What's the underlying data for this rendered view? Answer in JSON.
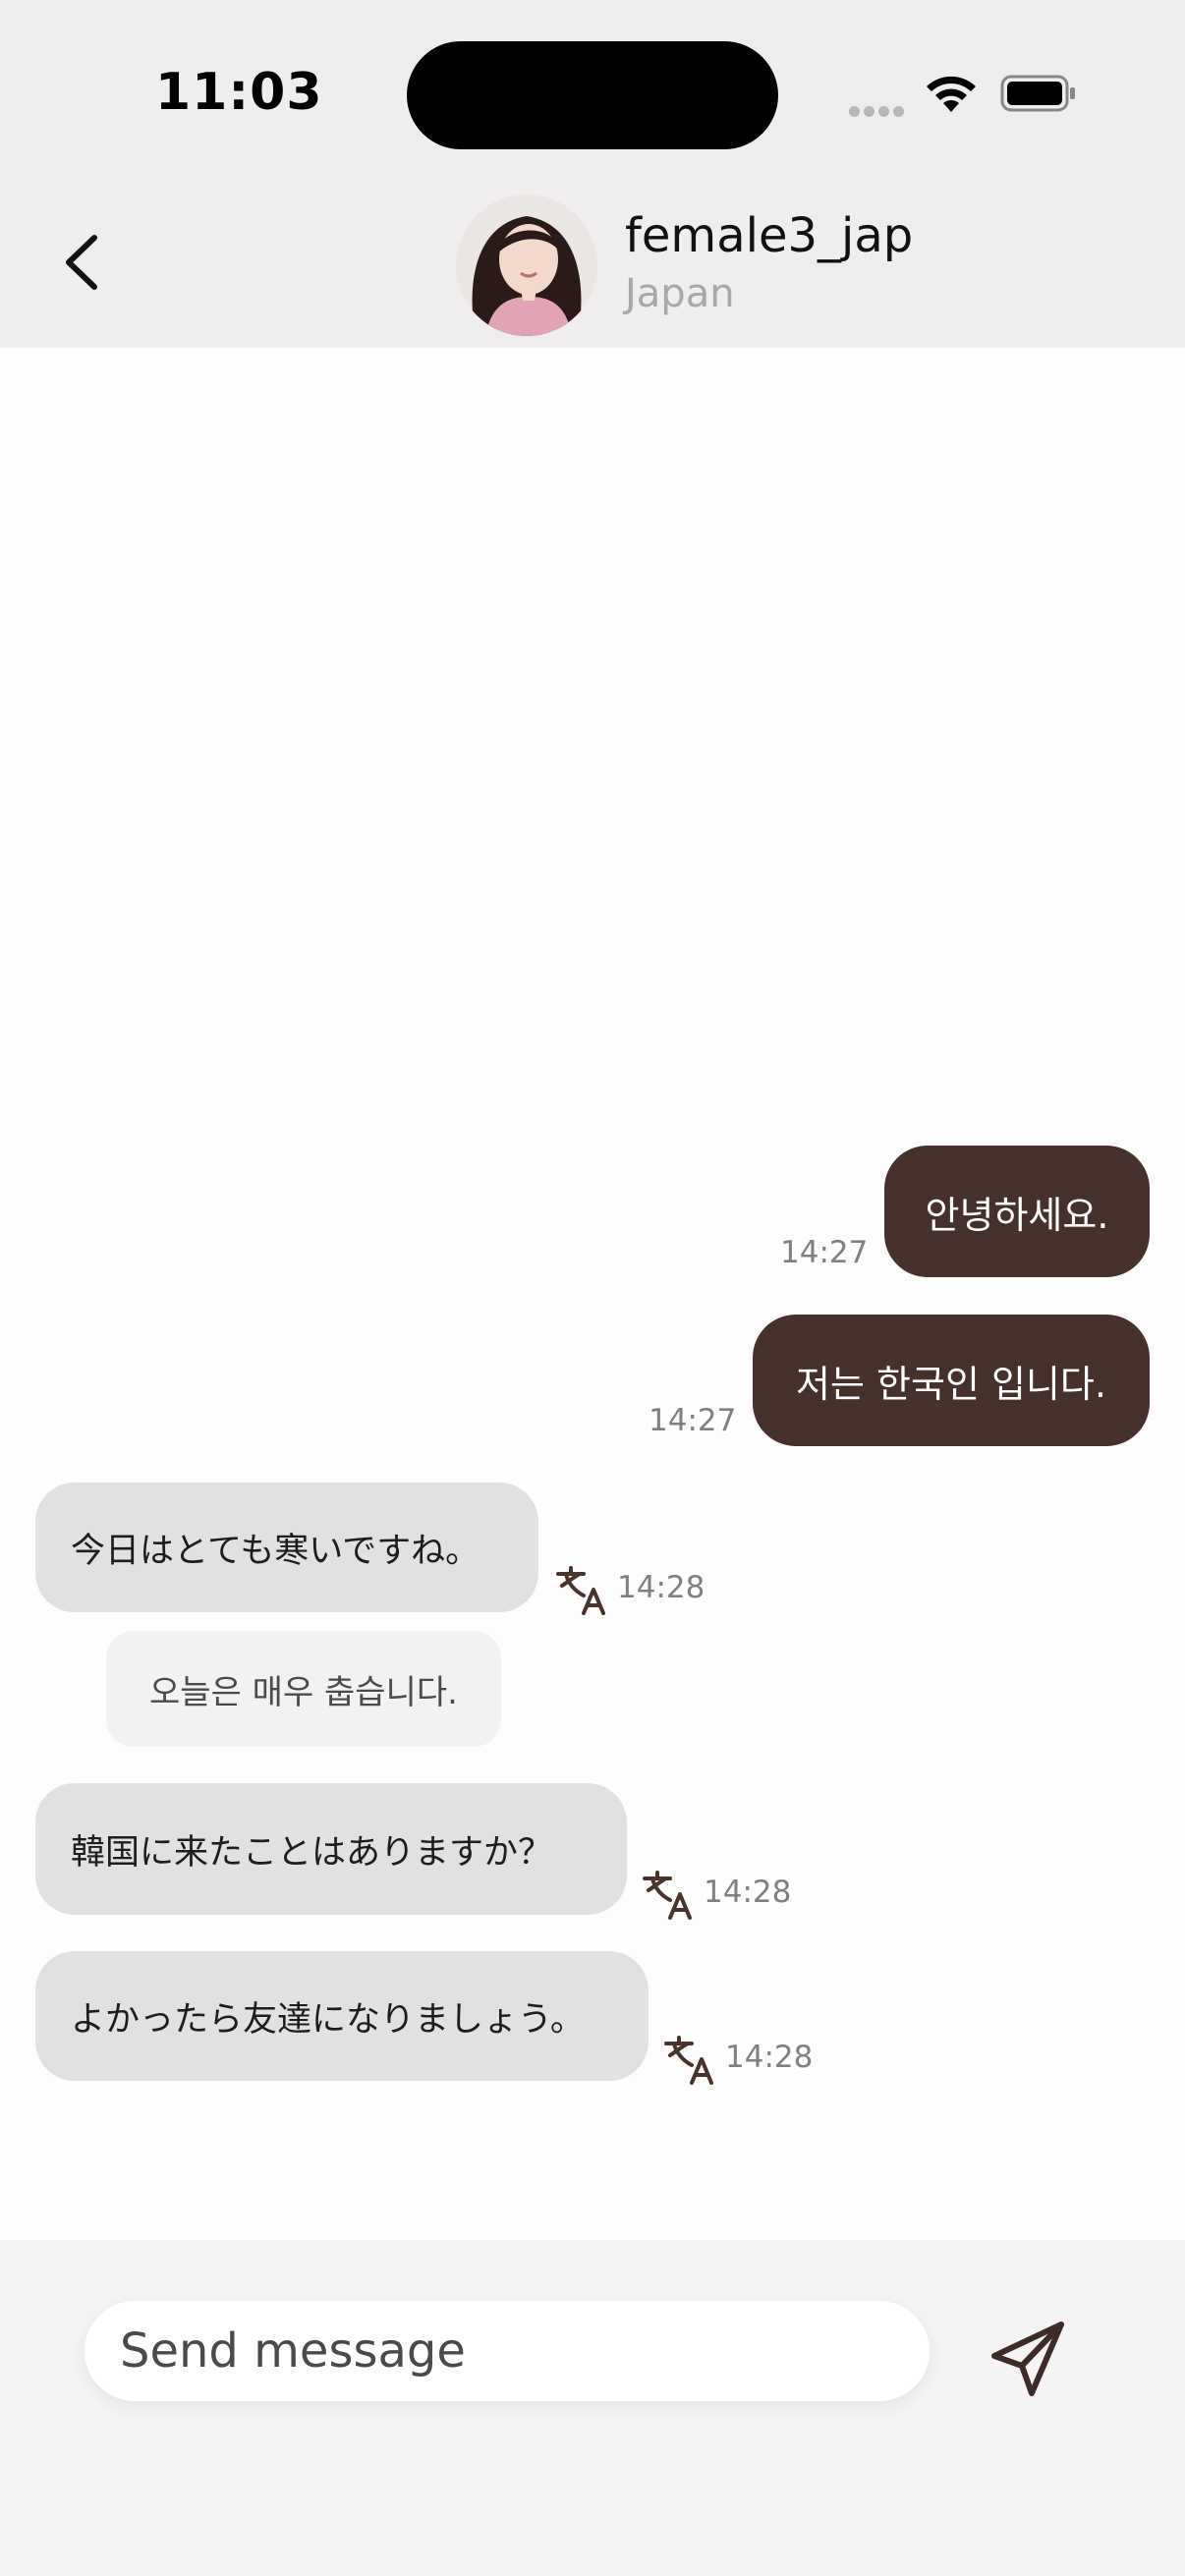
{
  "status_bar": {
    "time": "11:03"
  },
  "header": {
    "back_icon": "chevron-left-icon",
    "name": "female3_jap",
    "country": "Japan"
  },
  "messages": [
    {
      "direction": "out",
      "text": "안녕하세요.",
      "time": "14:27"
    },
    {
      "direction": "out",
      "text": "저는 한국인 입니다.",
      "time": "14:27"
    },
    {
      "direction": "in",
      "text": "今日はとても寒いですね。",
      "time": "14:28",
      "translation": "오늘은 매우 춥습니다."
    },
    {
      "direction": "in",
      "text": "韓国に来たことはありますか？",
      "time": "14:28"
    },
    {
      "direction": "in",
      "text": "よかったら友達になりましょう。",
      "time": "14:28"
    }
  ],
  "composer": {
    "placeholder": "Send message",
    "send_icon": "paper-plane-icon"
  },
  "colors": {
    "outgoing_bubble": "#45302b",
    "incoming_bubble": "#e1e1e1",
    "header_bg": "#efeded",
    "accent": "#3d2b27"
  }
}
